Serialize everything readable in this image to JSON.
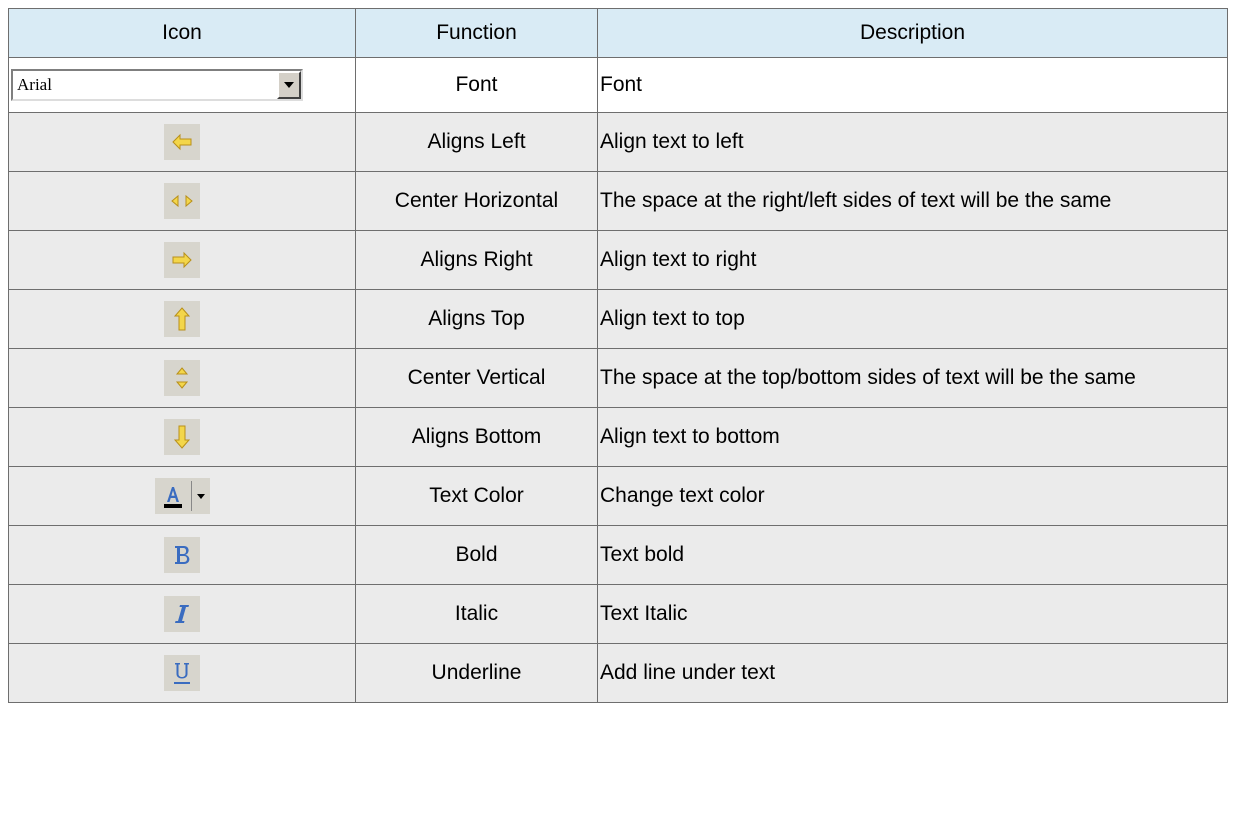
{
  "table": {
    "headers": {
      "icon": "Icon",
      "function": "Function",
      "description": "Description"
    },
    "font_select_value": "Arial",
    "rows": [
      {
        "icon": "font-select",
        "function": "Font",
        "description": "Font"
      },
      {
        "icon": "align-left-icon",
        "function": "Aligns Left",
        "description": "Align text to left"
      },
      {
        "icon": "center-horizontal-icon",
        "function": "Center Horizontal",
        "description": "The space at the right/left sides of text will be the same"
      },
      {
        "icon": "align-right-icon",
        "function": "Aligns Right",
        "description": "Align text to right"
      },
      {
        "icon": "align-top-icon",
        "function": "Aligns Top",
        "description": "Align text to top"
      },
      {
        "icon": "center-vertical-icon",
        "function": "Center Vertical",
        "description": "The space at the top/bottom sides of text will be the same"
      },
      {
        "icon": "align-bottom-icon",
        "function": "Aligns Bottom",
        "description": "Align text to bottom"
      },
      {
        "icon": "text-color-icon",
        "function": "Text Color",
        "description": "Change text color"
      },
      {
        "icon": "bold-icon",
        "function": "Bold",
        "description": "Text bold"
      },
      {
        "icon": "italic-icon",
        "function": "Italic",
        "description": "Text Italic"
      },
      {
        "icon": "underline-icon",
        "function": "Underline",
        "description": "Add line under text"
      }
    ]
  },
  "colors": {
    "header_bg": "#d9ebf5",
    "row_bg": "#ebebeb",
    "arrow_fill": "#f3d64a",
    "format_icon_blue": "#3a6cc0"
  }
}
